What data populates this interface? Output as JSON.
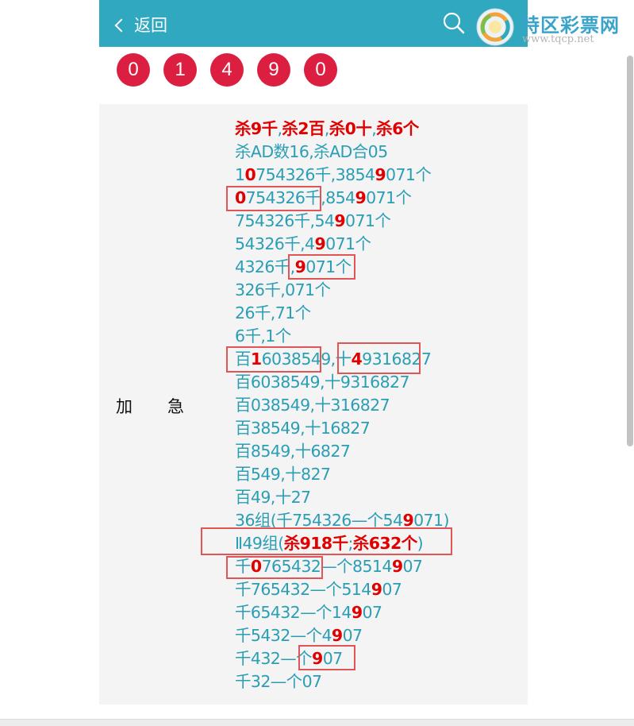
{
  "header": {
    "back_label": "返回"
  },
  "logo": {
    "text": "特区彩票网",
    "url": "www.tqcp.net"
  },
  "balls": [
    "0",
    "1",
    "4",
    "9",
    "0"
  ],
  "section": {
    "tag": "加急"
  },
  "lines": [
    [
      [
        "杀9千",
        true
      ],
      [
        ",",
        false
      ],
      [
        "杀2百",
        true
      ],
      [
        ",",
        false
      ],
      [
        "杀0十",
        true
      ],
      [
        ",",
        false
      ],
      [
        "杀6个",
        true
      ]
    ],
    [
      [
        "杀AD数16,杀AD合05",
        false
      ]
    ],
    [
      [
        "1",
        false
      ],
      [
        "0",
        true
      ],
      [
        "754326千,3854",
        false
      ],
      [
        "9",
        true
      ],
      [
        "071个",
        false
      ]
    ],
    [
      [
        "0",
        true
      ],
      [
        "754326千,854",
        false
      ],
      [
        "9",
        true
      ],
      [
        "071个",
        false
      ]
    ],
    [
      [
        "754326千,54",
        false
      ],
      [
        "9",
        true
      ],
      [
        "071个",
        false
      ]
    ],
    [
      [
        "54326千,4",
        false
      ],
      [
        "9",
        true
      ],
      [
        "071个",
        false
      ]
    ],
    [
      [
        "4326千,",
        false
      ],
      [
        "9",
        true
      ],
      [
        "071个",
        false
      ]
    ],
    [
      [
        "326千,071个",
        false
      ]
    ],
    [
      [
        "26千,71个",
        false
      ]
    ],
    [
      [
        "6千,1个",
        false
      ]
    ],
    [
      [
        "百",
        false
      ],
      [
        "1",
        true
      ],
      [
        "6038549,十",
        false
      ],
      [
        "4",
        true
      ],
      [
        "9316827",
        false
      ]
    ],
    [
      [
        "百6038549,十9316827",
        false
      ]
    ],
    [
      [
        "百038549,十316827",
        false
      ]
    ],
    [
      [
        "百38549,十16827",
        false
      ]
    ],
    [
      [
        "百8549,十6827",
        false
      ]
    ],
    [
      [
        "百549,十827",
        false
      ]
    ],
    [
      [
        "百49,十27",
        false
      ]
    ],
    [
      [
        "36组(千754326—个54",
        false
      ],
      [
        "9",
        true
      ],
      [
        "071)",
        false
      ]
    ],
    [
      [
        "Ⅱ49组(",
        false
      ],
      [
        "杀918千",
        true
      ],
      [
        ";",
        false
      ],
      [
        "杀632个",
        true
      ],
      [
        ")",
        false
      ]
    ],
    [
      [
        "千",
        false
      ],
      [
        "0",
        true
      ],
      [
        "765432—个8514",
        false
      ],
      [
        "9",
        true
      ],
      [
        "07",
        false
      ]
    ],
    [
      [
        "千765432—个514",
        false
      ],
      [
        "9",
        true
      ],
      [
        "07",
        false
      ]
    ],
    [
      [
        "千65432—个14",
        false
      ],
      [
        "9",
        true
      ],
      [
        "07",
        false
      ]
    ],
    [
      [
        "千5432—个4",
        false
      ],
      [
        "9",
        true
      ],
      [
        "07",
        false
      ]
    ],
    [
      [
        "千432—个",
        false
      ],
      [
        "9",
        true
      ],
      [
        "07",
        false
      ]
    ],
    [
      [
        "千32—个07",
        false
      ]
    ]
  ],
  "colors": {
    "header": "#2fa8c0",
    "ball": "#dc1e40",
    "text": "#2a9eb5",
    "highlight": "#e00000",
    "box": "#e05555"
  }
}
